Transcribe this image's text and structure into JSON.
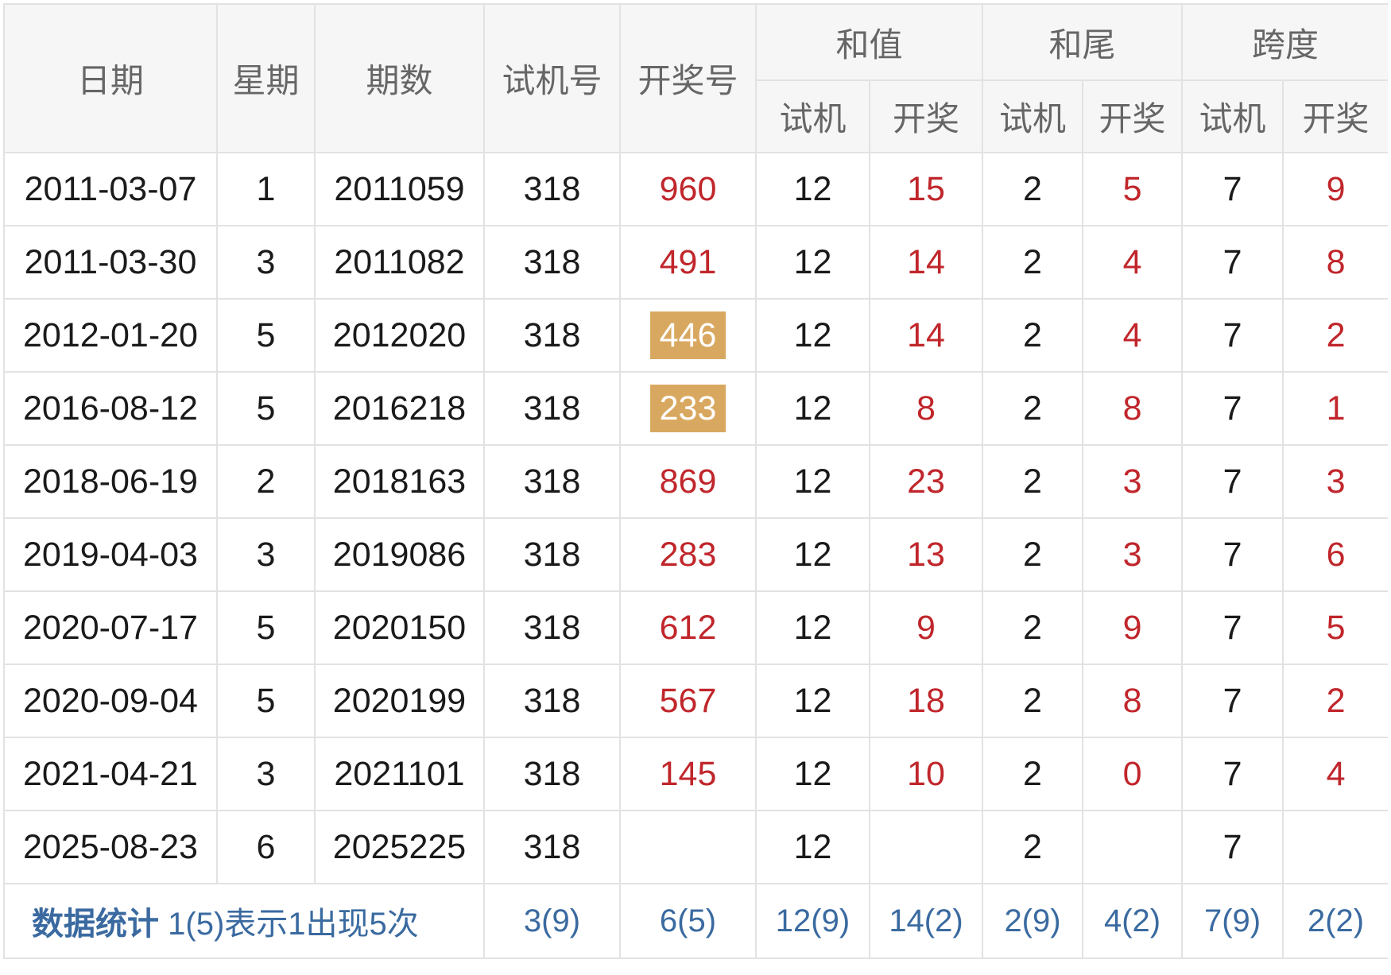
{
  "headers": {
    "date": "日期",
    "weekday": "星期",
    "issue": "期数",
    "trial_number": "试机号",
    "draw_number": "开奖号",
    "sum": "和值",
    "sum_tail": "和尾",
    "span": "跨度",
    "sub_trial": "试机",
    "sub_draw": "开奖"
  },
  "rows": [
    {
      "date": "2011-03-07",
      "weekday": "1",
      "issue": "2011059",
      "trial": "318",
      "draw": "960",
      "draw_highlight": false,
      "sum_trial": "12",
      "sum_draw": "15",
      "tail_trial": "2",
      "tail_draw": "5",
      "span_trial": "7",
      "span_draw": "9"
    },
    {
      "date": "2011-03-30",
      "weekday": "3",
      "issue": "2011082",
      "trial": "318",
      "draw": "491",
      "draw_highlight": false,
      "sum_trial": "12",
      "sum_draw": "14",
      "tail_trial": "2",
      "tail_draw": "4",
      "span_trial": "7",
      "span_draw": "8"
    },
    {
      "date": "2012-01-20",
      "weekday": "5",
      "issue": "2012020",
      "trial": "318",
      "draw": "446",
      "draw_highlight": true,
      "sum_trial": "12",
      "sum_draw": "14",
      "tail_trial": "2",
      "tail_draw": "4",
      "span_trial": "7",
      "span_draw": "2"
    },
    {
      "date": "2016-08-12",
      "weekday": "5",
      "issue": "2016218",
      "trial": "318",
      "draw": "233",
      "draw_highlight": true,
      "sum_trial": "12",
      "sum_draw": "8",
      "tail_trial": "2",
      "tail_draw": "8",
      "span_trial": "7",
      "span_draw": "1"
    },
    {
      "date": "2018-06-19",
      "weekday": "2",
      "issue": "2018163",
      "trial": "318",
      "draw": "869",
      "draw_highlight": false,
      "sum_trial": "12",
      "sum_draw": "23",
      "tail_trial": "2",
      "tail_draw": "3",
      "span_trial": "7",
      "span_draw": "3"
    },
    {
      "date": "2019-04-03",
      "weekday": "3",
      "issue": "2019086",
      "trial": "318",
      "draw": "283",
      "draw_highlight": false,
      "sum_trial": "12",
      "sum_draw": "13",
      "tail_trial": "2",
      "tail_draw": "3",
      "span_trial": "7",
      "span_draw": "6"
    },
    {
      "date": "2020-07-17",
      "weekday": "5",
      "issue": "2020150",
      "trial": "318",
      "draw": "612",
      "draw_highlight": false,
      "sum_trial": "12",
      "sum_draw": "9",
      "tail_trial": "2",
      "tail_draw": "9",
      "span_trial": "7",
      "span_draw": "5"
    },
    {
      "date": "2020-09-04",
      "weekday": "5",
      "issue": "2020199",
      "trial": "318",
      "draw": "567",
      "draw_highlight": false,
      "sum_trial": "12",
      "sum_draw": "18",
      "tail_trial": "2",
      "tail_draw": "8",
      "span_trial": "7",
      "span_draw": "2"
    },
    {
      "date": "2021-04-21",
      "weekday": "3",
      "issue": "2021101",
      "trial": "318",
      "draw": "145",
      "draw_highlight": false,
      "sum_trial": "12",
      "sum_draw": "10",
      "tail_trial": "2",
      "tail_draw": "0",
      "span_trial": "7",
      "span_draw": "4"
    },
    {
      "date": "2025-08-23",
      "weekday": "6",
      "issue": "2025225",
      "trial": "318",
      "draw": "",
      "draw_highlight": false,
      "sum_trial": "12",
      "sum_draw": "",
      "tail_trial": "2",
      "tail_draw": "",
      "span_trial": "7",
      "span_draw": ""
    }
  ],
  "stats": {
    "label_bold": "数据统计",
    "label_note": "1(5)表示1出现5次",
    "trial": "3(9)",
    "draw": "6(5)",
    "sum_trial": "12(9)",
    "sum_draw": "14(2)",
    "tail_trial": "2(9)",
    "tail_draw": "4(2)",
    "span_trial": "7(9)",
    "span_draw": "2(2)"
  },
  "colors": {
    "draw_text": "#c0262b",
    "highlight_bg": "#d9a860",
    "stats_text": "#3a6aa0",
    "header_bg": "#f6f6f6",
    "border": "#e2e2e2"
  }
}
